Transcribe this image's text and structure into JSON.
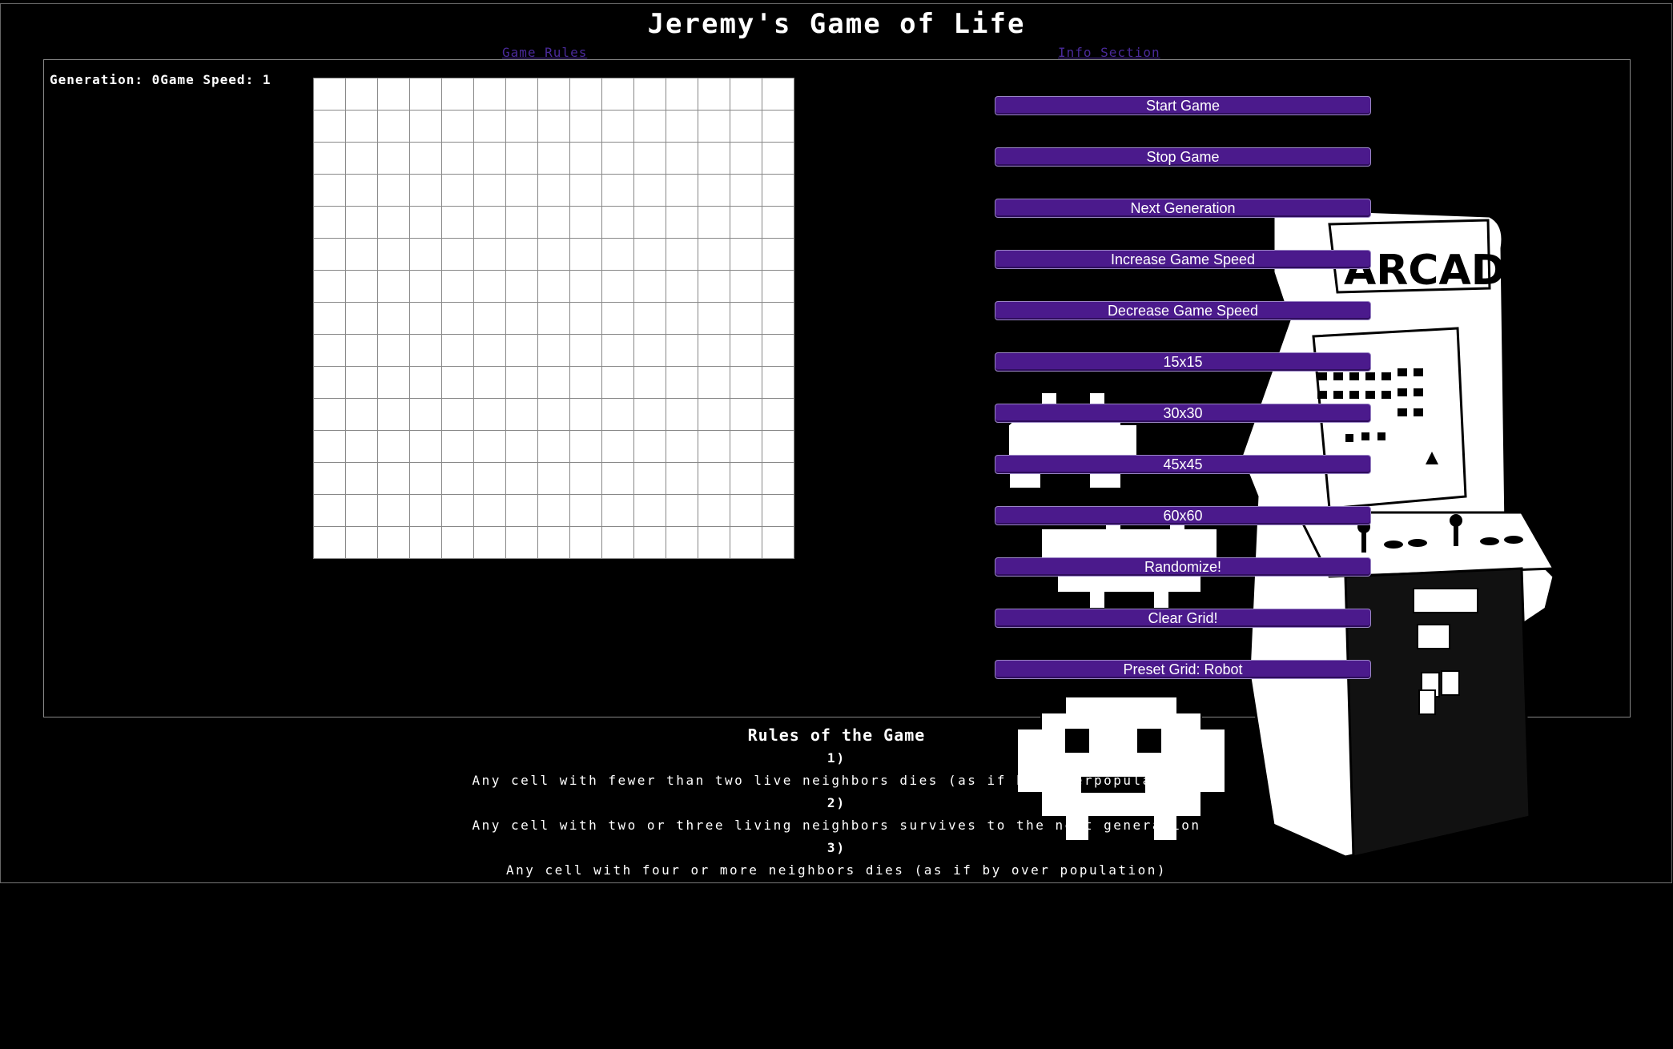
{
  "page": {
    "title": "Jeremy's Game of Life"
  },
  "nav": {
    "rules_link": "Game Rules",
    "info_link": "Info Section"
  },
  "stats": {
    "generation_label": "Generation: ",
    "generation": "0",
    "speed_label": "Game Speed: ",
    "speed": "1"
  },
  "grid": {
    "rows": 15,
    "cols": 15,
    "cell_color": "#ffffff",
    "line_color": "#888888"
  },
  "controls": [
    {
      "name": "start-game-button",
      "label": "Start Game"
    },
    {
      "name": "stop-game-button",
      "label": "Stop Game"
    },
    {
      "name": "next-generation-button",
      "label": "Next Generation"
    },
    {
      "name": "increase-speed-button",
      "label": "Increase Game Speed"
    },
    {
      "name": "decrease-speed-button",
      "label": "Decrease Game Speed"
    },
    {
      "name": "grid-15x15-button",
      "label": "15x15"
    },
    {
      "name": "grid-30x30-button",
      "label": "30x30"
    },
    {
      "name": "grid-45x45-button",
      "label": "45x45"
    },
    {
      "name": "grid-60x60-button",
      "label": "60x60"
    },
    {
      "name": "randomize-button",
      "label": "Randomize!"
    },
    {
      "name": "clear-grid-button",
      "label": "Clear Grid!"
    },
    {
      "name": "preset-robot-button",
      "label": "Preset Grid: Robot"
    }
  ],
  "art": {
    "marquee": "ARCADE"
  },
  "rules": {
    "title": "Rules of the Game",
    "items": [
      {
        "number": "1)",
        "text": "Any cell with fewer than two live neighbors dies (as if by underpopulation)"
      },
      {
        "number": "2)",
        "text": "Any cell with two or three living neighbors survives to the next generation"
      },
      {
        "number": "3)",
        "text": "Any cell with four or more neighbors dies (as if by over population)"
      }
    ]
  },
  "colors": {
    "accent": "#4b1a8c",
    "link": "#4a2a9a",
    "background": "#000000"
  }
}
